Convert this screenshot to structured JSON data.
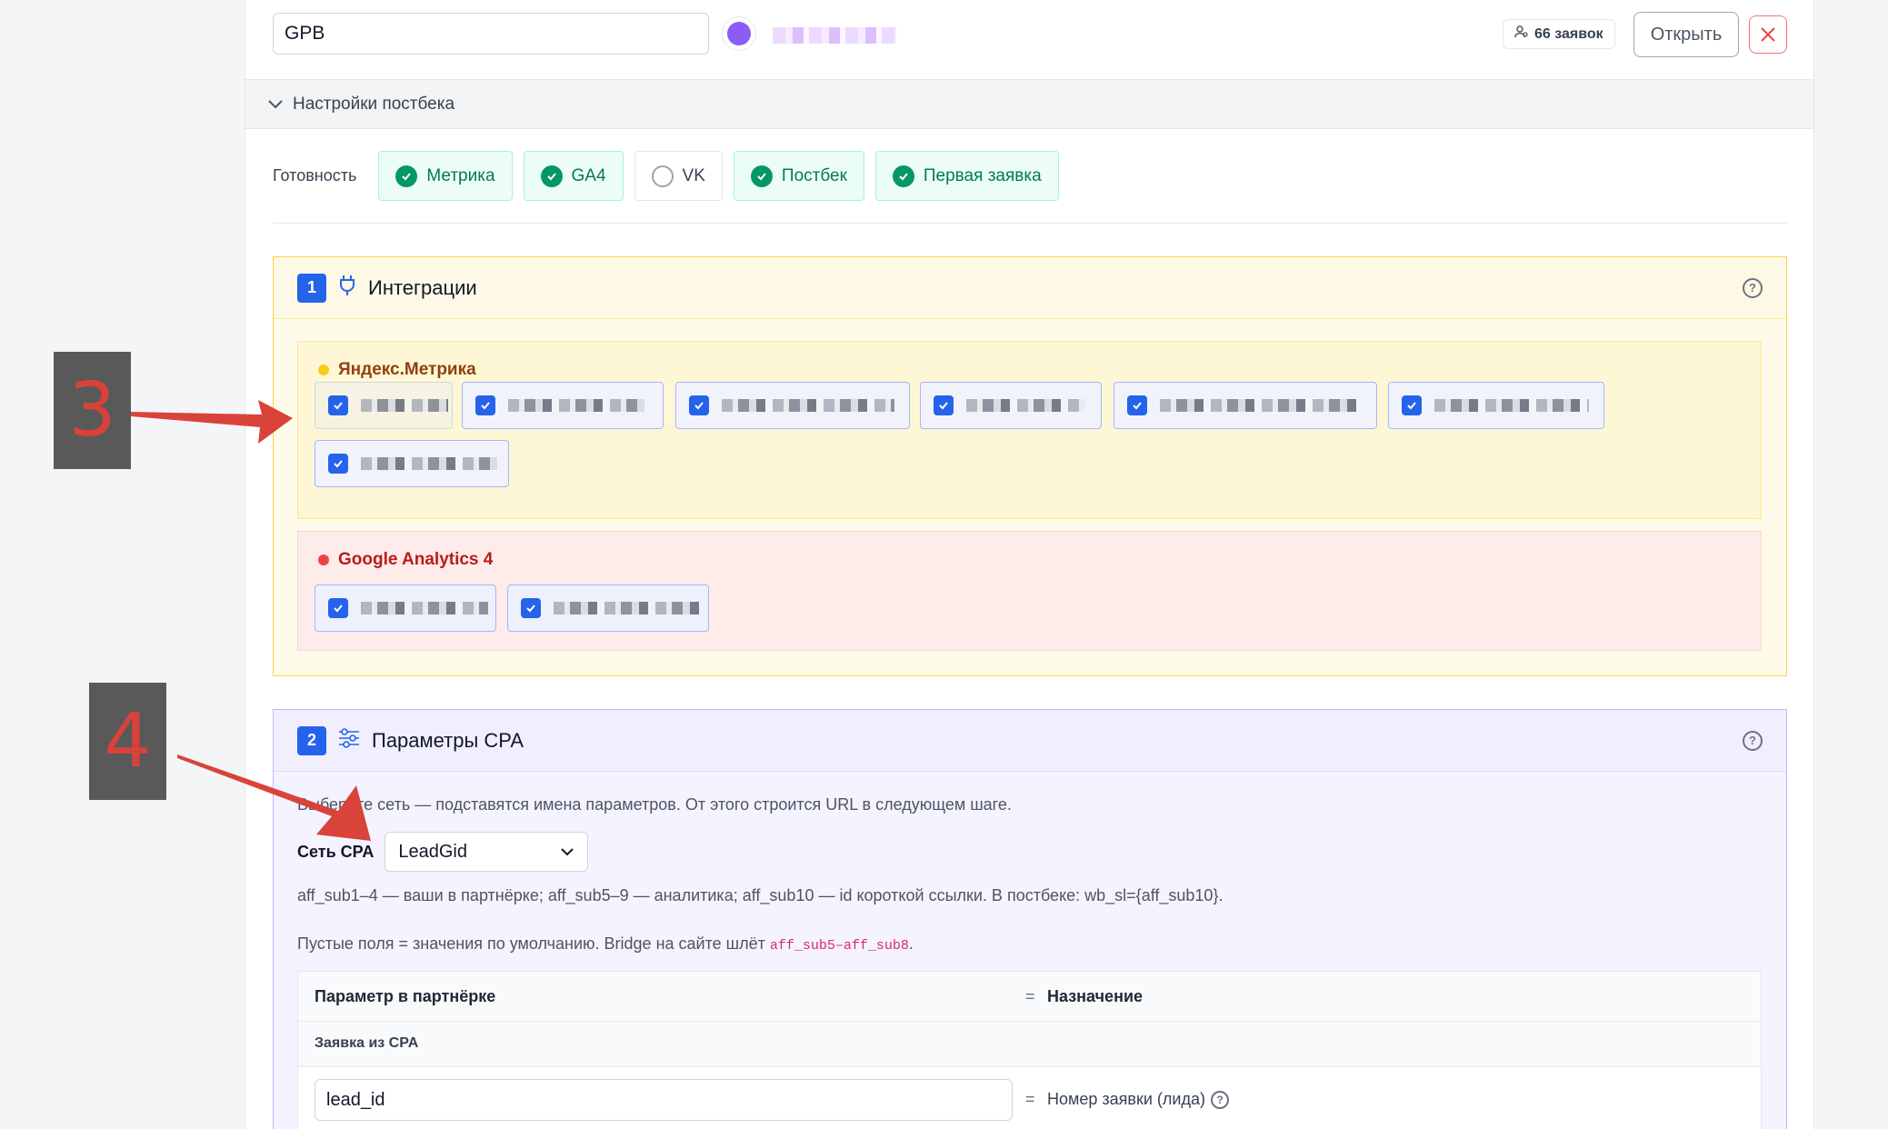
{
  "top": {
    "name_value": "GPB",
    "dot_color": "#8b5cf6",
    "leads_count": "66 заявок",
    "open_label": "Открыть"
  },
  "settings": {
    "title": "Настройки постбека"
  },
  "readiness": {
    "label": "Готовность",
    "chips": [
      {
        "label": "Метрика",
        "ok": true
      },
      {
        "label": "GA4",
        "ok": true
      },
      {
        "label": "VK",
        "ok": false
      },
      {
        "label": "Постбек",
        "ok": true
      },
      {
        "label": "Первая заявка",
        "ok": true
      }
    ]
  },
  "integrations": {
    "number": "1",
    "title": "Интеграции",
    "help": "?",
    "yandex": {
      "title": "Яндекс.Метрика",
      "color": "#facc15"
    },
    "ga": {
      "title": "Google Analytics 4",
      "color": "#ef4444"
    }
  },
  "cpa": {
    "number": "2",
    "title": "Параметры CPA",
    "help": "?",
    "description": "Выберите сеть — подставятся имена параметров. От этого строится URL в следующем шаге.",
    "network_label": "Сеть CPA",
    "network_value": "LeadGid",
    "hint1": "aff_sub1–4 — ваши в партнёрке; aff_sub5–9 — аналитика; aff_sub10 — id короткой ссылки. В постбеке: wb_sl={aff_sub10}.",
    "hint2_prefix": "Пустые поля = значения по умолчанию. Bridge на сайте шлёт ",
    "hint2_code1": "aff_sub5",
    "hint2_dash": "–",
    "hint2_code2": "aff_sub8",
    "hint2_suffix": ".",
    "table": {
      "col1": "Параметр в партнёрке",
      "eq": "=",
      "col2": "Назначение",
      "group": "Заявка из CPA",
      "row_value": "lead_id",
      "row_dest": "Номер заявки (лида)"
    }
  },
  "annotations": {
    "a3": "3",
    "a4": "4"
  }
}
